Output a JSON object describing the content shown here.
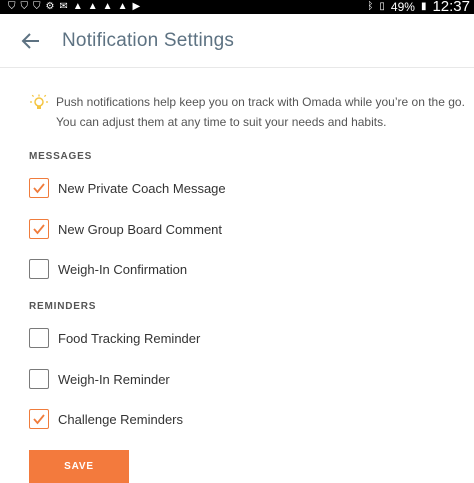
{
  "status_bar": {
    "battery": "49%",
    "time": "12:37"
  },
  "header": {
    "title": "Notification Settings",
    "back_icon": "back-arrow-icon"
  },
  "tip": {
    "icon": "lightbulb-icon",
    "line1": "Push notifications help keep you on track with Omada while you’re on the go.",
    "line2": "You can adjust them at any time to suit your needs and habits."
  },
  "messages": {
    "header": "MESSAGES",
    "items": [
      {
        "label": "New Private Coach Message",
        "checked": true
      },
      {
        "label": "New Group Board Comment",
        "checked": true
      },
      {
        "label": "Weigh-In Confirmation",
        "checked": false
      }
    ]
  },
  "reminders": {
    "header": "REMINDERS",
    "items": [
      {
        "label": "Food Tracking Reminder",
        "checked": false
      },
      {
        "label": "Weigh-In Reminder",
        "checked": false
      },
      {
        "label": "Challenge Reminders",
        "checked": true
      }
    ]
  },
  "save_label": "SAVE",
  "colors": {
    "accent": "#f37a3d",
    "title": "#5d7282",
    "bulb": "#f4c542"
  }
}
